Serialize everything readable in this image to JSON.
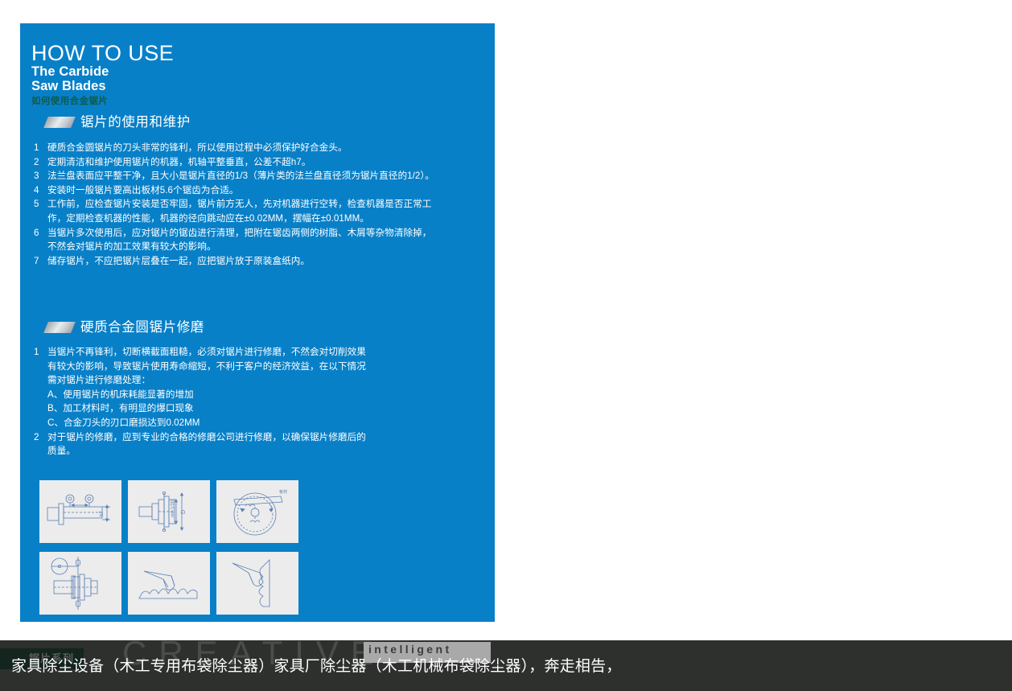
{
  "colors": {
    "panel_blue": "#0880C8",
    "heading_white": "#FFFFFF",
    "cn_subtitle_green": "#0D5B4C",
    "thumb_bg": "#ECECEC",
    "strip_dark": "#2E302E"
  },
  "header": {
    "title_line1": "HOW TO USE",
    "title_line2": "The Carbide",
    "title_line3": "Saw Blades",
    "title_cn": "如何使用合金锯片"
  },
  "section1": {
    "heading": "锯片的使用和维护",
    "items": [
      {
        "num": "1",
        "text": "硬质合金圆锯片的刀头非常的锋利，所以使用过程中必须保护好合金头。"
      },
      {
        "num": "2",
        "text": "定期清洁和维护使用锯片的机器，机轴平整垂直，公差不超h7。"
      },
      {
        "num": "3",
        "text": "法兰盘表面应平整干净，且大小是锯片直径的1/3（薄片类的法兰盘直径须为锯片直径的1/2）。"
      },
      {
        "num": "4",
        "text": "安装时一般锯片要高出板材5.6个锯齿为合适。"
      },
      {
        "num": "5",
        "text": "工作前，应检查锯片安装是否牢固，锯片前方无人，先对机器进行空转，检查机器是否正常工作，定期检查机器的性能，机器的径向跳动应在±0.02MM，摆幅在±0.01MM。"
      },
      {
        "num": "6",
        "text": "当锯片多次使用后，应对锯片的锯齿进行清理，把附在锯齿两侧的树脂、木屑等杂物清除掉，不然会对锯片的加工效果有较大的影响。"
      },
      {
        "num": "7",
        "text": "储存锯片，不应把锯片层叠在一起，应把锯片放于原装盒纸内。"
      }
    ]
  },
  "section2": {
    "heading": "硬质合金圆锯片修磨",
    "item1": {
      "num": "1",
      "text": "当锯片不再锋利，切断横截面粗糙，必须对锯片进行修磨，不然会对切削效果有较大的影响，导致锯片使用寿命缩短，不利于客户的经济效益，在以下情况需对锯片进行修磨处理："
    },
    "sub_items": [
      "A、使用锯片的机床耗能显著的增加",
      "B、加工材料时，有明显的爆口现象",
      "C、合金刀头的刃口磨损达到0.02MM"
    ],
    "item2": {
      "num": "2",
      "text": "对于锯片的修磨，应到专业的合格的修磨公司进行修磨，以确保锯片修磨后的质量。"
    }
  },
  "thumbnails": [
    {
      "name": "arbor-runout-diagram",
      "label": "h7"
    },
    {
      "name": "flange-diameter-diagram",
      "label": "min 1/3D"
    },
    {
      "name": "saw-blade-board-diagram",
      "label": "板材"
    },
    {
      "name": "dial-indicator-diagram",
      "label": ""
    },
    {
      "name": "tooth-profile-diagram",
      "label": ""
    },
    {
      "name": "tooth-grinding-diagram",
      "label": ""
    }
  ],
  "bottom": {
    "watermark_creative": "CREATIVE",
    "watermark_intelligent": "intelligent",
    "watermark_cn": "锯片系列",
    "caption": "家具除尘设备（木工专用布袋除尘器）家具厂除尘器（木工机械布袋除尘器），奔走相告，"
  }
}
